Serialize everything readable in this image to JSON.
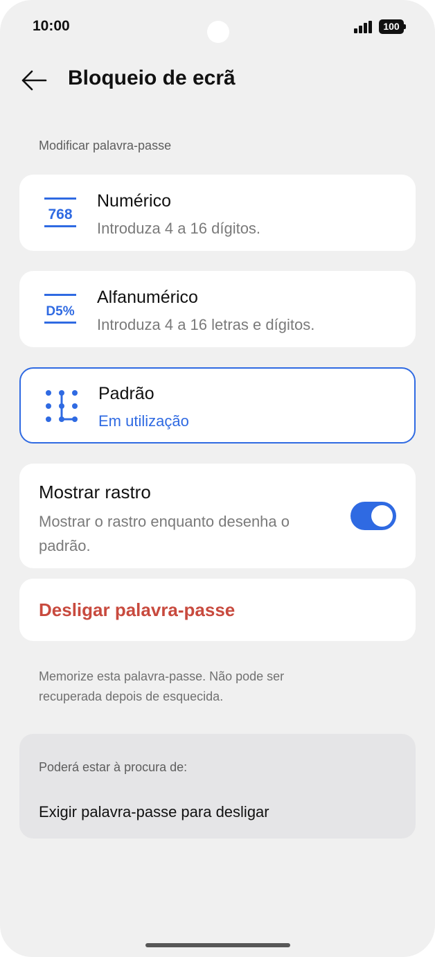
{
  "status": {
    "time": "10:00",
    "battery": "100"
  },
  "header": {
    "title": "Bloqueio de ecrã"
  },
  "section_label": "Modificar palavra-passe",
  "options": [
    {
      "icon_text": "768",
      "title": "Numérico",
      "subtitle": "Introduza 4 a 16 dígitos."
    },
    {
      "icon_text": "D5%",
      "title": "Alfanumérico",
      "subtitle": "Introduza 4 a 16 letras e dígitos."
    },
    {
      "title": "Padrão",
      "subtitle": "Em utilização",
      "selected": true
    }
  ],
  "trail": {
    "title": "Mostrar rastro",
    "description": "Mostrar o rastro enquanto desenha o padrão.",
    "enabled": true
  },
  "disable_label": "Desligar palavra-passe",
  "note": "Memorize esta palavra-passe. Não pode ser recuperada depois de esquecida.",
  "suggestions": {
    "label": "Poderá estar à procura de:",
    "items": [
      "Exigir palavra-passe para desligar"
    ]
  },
  "colors": {
    "accent": "#2f6ae2",
    "danger": "#c84a3e"
  }
}
